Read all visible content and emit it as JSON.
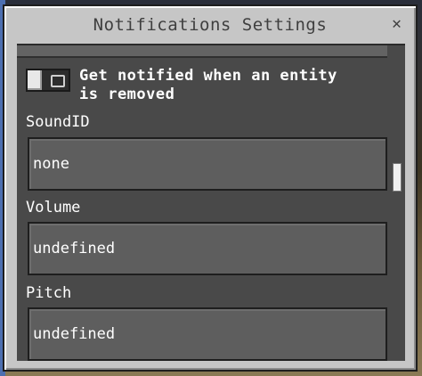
{
  "window": {
    "title": "Notifications Settings",
    "close_label": "✕"
  },
  "toggle": {
    "label_line1": "Get notified when an entity",
    "label_line2": "is removed",
    "state": "off"
  },
  "fields": {
    "sound_id": {
      "label": "SoundID",
      "value": "none"
    },
    "volume": {
      "label": "Volume",
      "value": "undefined"
    },
    "pitch": {
      "label": "Pitch",
      "value": "undefined"
    }
  }
}
